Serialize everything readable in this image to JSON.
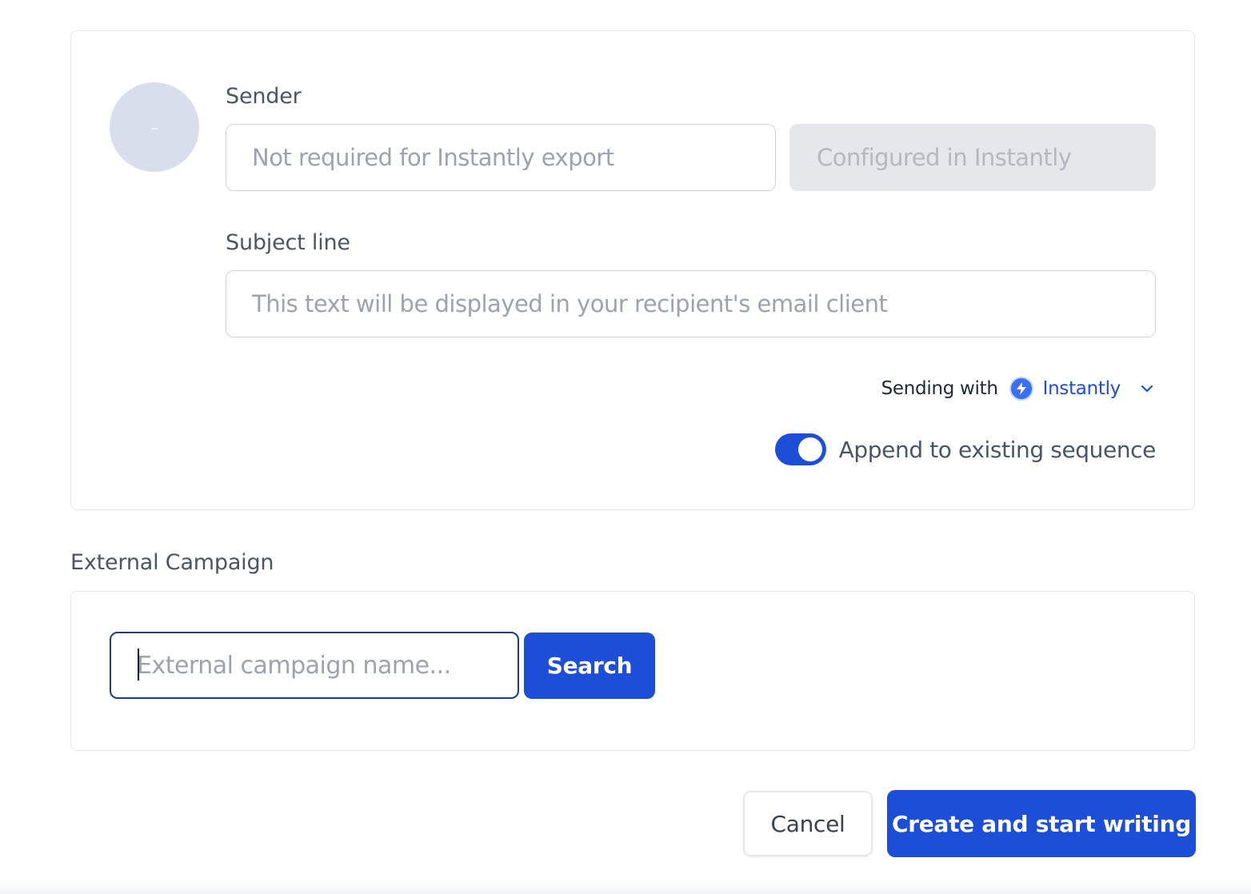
{
  "sender_card": {
    "avatar_initial": "-",
    "sender_label": "Sender",
    "sender_placeholder": "Not required for Instantly export",
    "sender_config_text": "Configured in Instantly",
    "subject_label": "Subject line",
    "subject_placeholder": "This text will be displayed in your recipient's email client",
    "sending_with_label": "Sending with",
    "provider_name": "Instantly",
    "provider_icon": "lightning-bolt-icon",
    "append_label": "Append to existing sequence",
    "append_enabled": true
  },
  "external_campaign": {
    "section_label": "External Campaign",
    "input_placeholder": "External campaign name...",
    "search_label": "Search"
  },
  "actions": {
    "cancel_label": "Cancel",
    "create_label": "Create and start writing"
  },
  "colors": {
    "primary": "#1d4ed8",
    "avatar_bg": "#d8deec",
    "disabled_bg": "#e5e7eb"
  }
}
